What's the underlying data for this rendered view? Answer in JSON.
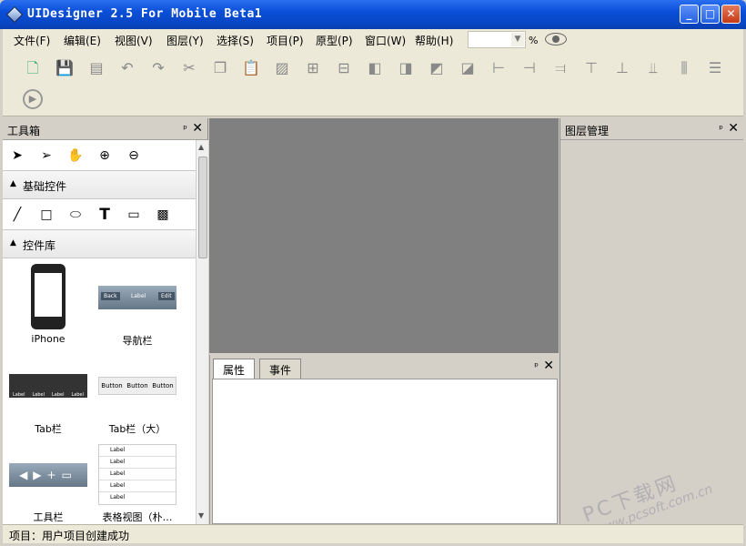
{
  "window": {
    "title": "UIDesigner 2.5 For Mobile Beta1"
  },
  "menu": [
    "文件(F)",
    "编辑(E)",
    "视图(V)",
    "图层(Y)",
    "选择(S)",
    "项目(P)",
    "原型(P)",
    "窗口(W)",
    "帮助(H)"
  ],
  "zoom": {
    "value": "",
    "unit": "%"
  },
  "toolbar_icons": [
    "new-file",
    "save",
    "open",
    "undo",
    "redo",
    "cut",
    "copy",
    "paste",
    "image",
    "group",
    "ungroup",
    "bring-forward",
    "send-backward",
    "bring-front",
    "send-back",
    "align-left",
    "align-center-h",
    "align-right",
    "align-top",
    "align-middle",
    "align-bottom",
    "distribute-h",
    "distribute-v",
    "preview"
  ],
  "toolbox": {
    "title": "工具箱",
    "pin": "ᵖ",
    "close": "✕",
    "tools": [
      "arrow-select",
      "direct-select",
      "hand",
      "zoom-in",
      "zoom-out"
    ],
    "basic_section": "基础控件",
    "shapes": [
      "line",
      "rectangle",
      "ellipse",
      "text",
      "button-shape",
      "image-shape"
    ],
    "library_section": "控件库",
    "library": [
      {
        "label": "iPhone"
      },
      {
        "label": "导航栏",
        "nav": {
          "back": "Back",
          "label": "Label",
          "edit": "Edit"
        }
      },
      {
        "label": "Tab栏",
        "tabs": [
          "Label",
          "Label",
          "Label",
          "Label"
        ]
      },
      {
        "label": "Tab栏（大）",
        "buttons": [
          "Button",
          "Button",
          "Button"
        ]
      },
      {
        "label": "工具栏"
      },
      {
        "label": "表格视图（朴…",
        "rows": [
          "Label",
          "Label",
          "Label",
          "Label",
          "Label"
        ]
      }
    ]
  },
  "properties": {
    "tabs": [
      "属性",
      "事件"
    ],
    "pin": "ᵖ",
    "close": "✕"
  },
  "layers": {
    "title": "图层管理",
    "pin": "ᵖ",
    "close": "✕"
  },
  "status": "项目：用户项目创建成功",
  "watermark": {
    "line1": "PC下载网",
    "line2": "www.pcsoft.com.cn"
  }
}
